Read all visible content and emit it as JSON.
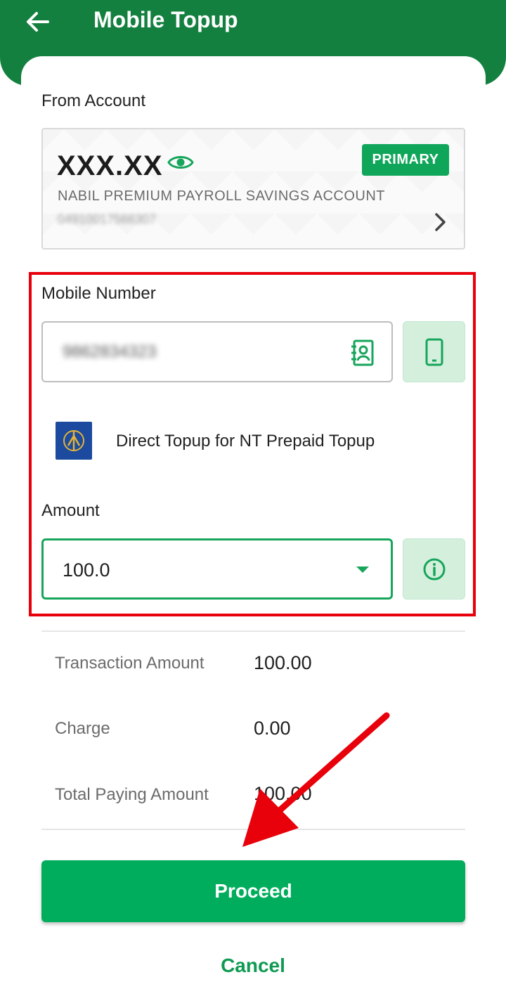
{
  "header": {
    "title": "Mobile Topup",
    "back_icon": "arrow-left-icon"
  },
  "from_account": {
    "label": "From Account",
    "balance": "XXX.XX",
    "eye_icon": "eye-icon",
    "badge": "PRIMARY",
    "account_name": "NABIL PREMIUM PAYROLL SAVINGS ACCOUNT",
    "account_number": "04910017566307"
  },
  "mobile": {
    "label": "Mobile Number",
    "value": "9862834323",
    "contact_icon": "contact-book-icon",
    "phone_icon": "smartphone-icon"
  },
  "operator": {
    "text": "Direct Topup for NT Prepaid Topup"
  },
  "amount": {
    "label": "Amount",
    "value": "100.0",
    "info_icon": "info-icon"
  },
  "summary": {
    "transaction_label": "Transaction Amount",
    "transaction_value": "100.00",
    "charge_label": "Charge",
    "charge_value": "0.00",
    "total_label": "Total Paying Amount",
    "total_value": "100.00"
  },
  "actions": {
    "proceed": "Proceed",
    "cancel": "Cancel"
  },
  "colors": {
    "brand_green": "#14803f",
    "button_green": "#00ad5d",
    "highlight_red": "#e8000b"
  }
}
